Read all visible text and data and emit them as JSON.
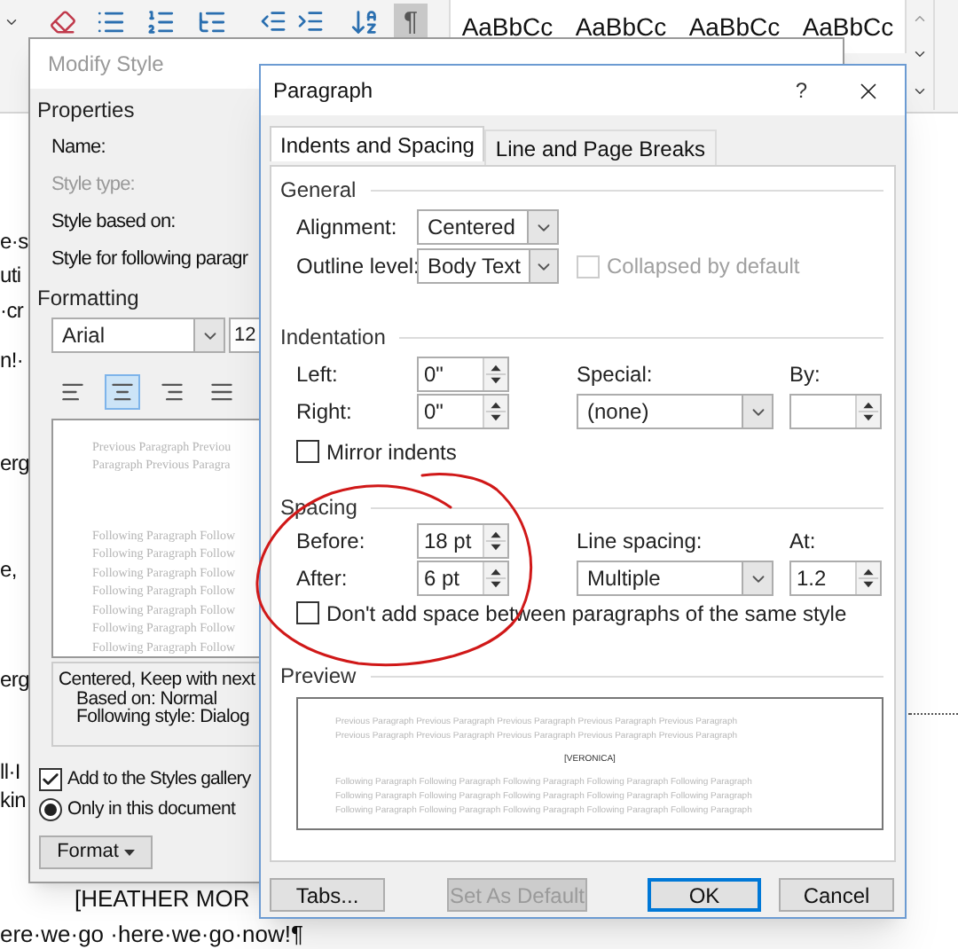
{
  "ribbon": {
    "show_marks": {
      "text": "¶",
      "selected": true
    },
    "styles": [
      {
        "label": "AaBbCc"
      },
      {
        "label": "AaBbCc"
      },
      {
        "label": "AaBbCc"
      },
      {
        "label": "AaBbCc"
      }
    ]
  },
  "document": {
    "lines": [
      "e·s",
      "uti",
      "·cr",
      "n!·",
      "erg",
      "e,",
      "erg",
      "ll·I",
      "kin"
    ],
    "heading": "[HEATHER MOR",
    "last_line": "ere·we·go ·here·we·go·now!¶"
  },
  "modify_style": {
    "title": "Modify Style",
    "properties_heading": "Properties",
    "property_labels": [
      {
        "text": "Name:",
        "disabled": false
      },
      {
        "text": "Style type:",
        "disabled": true
      },
      {
        "text": "Style based on:",
        "disabled": false
      },
      {
        "text": "Style for following paragr",
        "disabled": false
      }
    ],
    "formatting_heading": "Formatting",
    "font": "Arial",
    "font_size": "12",
    "alignments": [
      {
        "selected": false
      },
      {
        "selected": true
      },
      {
        "selected": false
      },
      {
        "selected": false
      }
    ],
    "preview_previous": [
      "Previous Paragraph Previou",
      "Paragraph Previous Paragra"
    ],
    "preview_following": [
      "Following Paragraph Follow",
      "Following Paragraph Follow",
      "Following Paragraph Follow",
      "Following Paragraph Follow",
      "Following Paragraph Follow",
      "Following Paragraph Follow",
      "Following Paragraph Follow"
    ],
    "description": [
      "Centered, Keep with next",
      "Based on: Normal",
      "Following style: Dialog"
    ],
    "add_to_gallery": {
      "label": "Add to the Styles gallery",
      "checked": true
    },
    "scope": [
      {
        "label": "Only in this document",
        "selected": true
      }
    ],
    "format_button": "Format"
  },
  "paragraph": {
    "title": "Paragraph",
    "help": "?",
    "tabs": [
      {
        "label": "Indents and Spacing",
        "selected": true
      },
      {
        "label": "Line and Page Breaks",
        "selected": false
      }
    ],
    "general": {
      "heading": "General",
      "alignment": {
        "label": "Alignment:",
        "value": "Centered"
      },
      "outline_level": {
        "label": "Outline level:",
        "value": "Body Text"
      },
      "collapsed": {
        "label": "Collapsed by default",
        "checked": false,
        "disabled": true
      }
    },
    "indentation": {
      "heading": "Indentation",
      "left": {
        "label": "Left:",
        "value": "0\""
      },
      "right": {
        "label": "Right:",
        "value": "0\""
      },
      "special": {
        "label": "Special:",
        "value": "(none)"
      },
      "by": {
        "label": "By:"
      },
      "mirror": {
        "label": "Mirror indents",
        "checked": false
      }
    },
    "spacing": {
      "heading": "Spacing",
      "before": {
        "label": "Before:",
        "value": "18 pt"
      },
      "after": {
        "label": "After:",
        "value": "6 pt"
      },
      "line_spacing": {
        "label": "Line spacing:",
        "value": "Multiple"
      },
      "at": {
        "label": "At:",
        "value": "1.2"
      },
      "dont_add": {
        "label": "Don't add space between paragraphs of the same style",
        "checked": false
      }
    },
    "preview": {
      "heading": "Preview",
      "previous": [
        "Previous Paragraph Previous Paragraph Previous Paragraph Previous Paragraph Previous Paragraph",
        "Previous Paragraph Previous Paragraph Previous Paragraph Previous Paragraph Previous Paragraph"
      ],
      "sample": "[VERONICA]",
      "following": [
        "Following Paragraph Following Paragraph Following Paragraph Following Paragraph Following Paragraph",
        "Following Paragraph Following Paragraph Following Paragraph Following Paragraph Following Paragraph",
        "Following Paragraph Following Paragraph Following Paragraph Following Paragraph Following Paragraph"
      ]
    },
    "buttons": [
      {
        "label": "Tabs...",
        "disabled": false,
        "default": false
      },
      {
        "label": "Set As Default",
        "disabled": true,
        "default": false
      },
      {
        "label": "OK",
        "disabled": false,
        "default": true
      },
      {
        "label": "Cancel",
        "disabled": false,
        "default": false
      }
    ]
  }
}
